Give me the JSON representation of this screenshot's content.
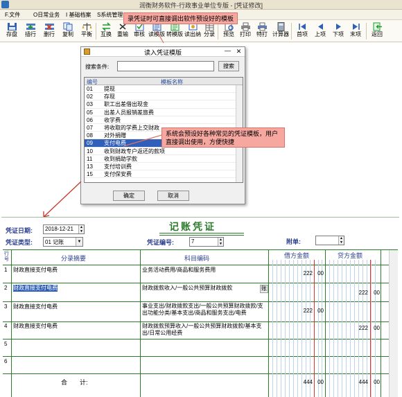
{
  "app": {
    "title": "润衡财务软件-行政事业单位专版 - [凭证修改]"
  },
  "menu": [
    {
      "label": "F.文件"
    },
    {
      "label": "O日常业务"
    },
    {
      "label": "I 基础档案"
    },
    {
      "label": "S系统管理"
    }
  ],
  "toolbar": [
    {
      "label": "存盘",
      "icon": "save-icon"
    },
    {
      "label": "插行",
      "icon": "insert-row-icon"
    },
    {
      "label": "删行",
      "icon": "delete-row-icon"
    },
    {
      "label": "复制",
      "icon": "copy-icon"
    },
    {
      "label": "平衡",
      "icon": "balance-icon"
    },
    {
      "label": "互换",
      "icon": "swap-icon"
    },
    {
      "label": "重输",
      "icon": "reset-icon"
    },
    {
      "label": "审核",
      "icon": "audit-icon"
    },
    {
      "label": "读模版",
      "icon": "read-template-icon"
    },
    {
      "label": "转模版",
      "icon": "save-template-icon"
    },
    {
      "label": "读出纳",
      "icon": "read-cashier-icon"
    },
    {
      "label": "分录",
      "icon": "entry-icon"
    },
    {
      "label": "预览",
      "icon": "preview-icon"
    },
    {
      "label": "打印",
      "icon": "print-icon"
    },
    {
      "label": "特打",
      "icon": "special-print-icon"
    },
    {
      "label": "计算器",
      "icon": "calculator-icon"
    },
    {
      "label": "首项",
      "icon": "first-icon"
    },
    {
      "label": "上项",
      "icon": "prev-icon"
    },
    {
      "label": "下项",
      "icon": "next-icon"
    },
    {
      "label": "末项",
      "icon": "last-icon"
    },
    {
      "label": "返回",
      "icon": "return-icon"
    }
  ],
  "callouts": {
    "top": "录凭证时可直接调出软件预设好的模板",
    "middle": "系统会预设好各种常见的凭证模板，用户直接调出使用，方便快捷"
  },
  "dialog": {
    "title": "读入凭证模版",
    "search_label": "搜索条件:",
    "search_value": "",
    "search_button": "搜索",
    "col_code": "编号",
    "col_name": "模板名称",
    "rows": [
      {
        "code": "01",
        "name": "提现"
      },
      {
        "code": "02",
        "name": "存现"
      },
      {
        "code": "03",
        "name": "职工出差借出现金"
      },
      {
        "code": "05",
        "name": "出差人员报销差旅费"
      },
      {
        "code": "06",
        "name": "收学费"
      },
      {
        "code": "07",
        "name": "将收取的学费上交财政"
      },
      {
        "code": "08",
        "name": "对外捐赠"
      },
      {
        "code": "09",
        "name": "支付电费"
      },
      {
        "code": "10",
        "name": "收到财政专户返还的款项"
      },
      {
        "code": "11",
        "name": "收到捐助学款"
      },
      {
        "code": "13",
        "name": "支付培训费"
      },
      {
        "code": "15",
        "name": "支付保安费"
      }
    ],
    "selected_index": 7,
    "ok": "确定",
    "cancel": "取消"
  },
  "voucher": {
    "title": "记账凭证",
    "date_label": "凭证日期:",
    "date_value": "2018-12-21",
    "type_label": "凭证类型:",
    "type_value": "01 记账",
    "number_label": "凭证编号:",
    "number_value": "7",
    "attach_label": "附单:",
    "attach_value": "",
    "col_rowno": "行号",
    "col_summary": "分录摘要",
    "col_account": "科目编码",
    "col_debit": "借方金额",
    "col_credit": "贷方金额",
    "digit_units": [
      "千",
      "百",
      "十",
      "亿",
      "千",
      "百",
      "十",
      "万",
      "千",
      "百",
      "十",
      "元",
      "角",
      "分"
    ],
    "rows": [
      {
        "no": "1",
        "summary": "财政直接支付电费",
        "account": "业务活动费用/商品和服务费用",
        "debit_int": "222",
        "debit_dec": "00",
        "credit_int": "",
        "credit_dec": ""
      },
      {
        "no": "2",
        "summary": "财政直接支付电费",
        "account": "财政拨款收入/一般公共预算财政拨款",
        "debit_int": "",
        "debit_dec": "",
        "credit_int": "222",
        "credit_dec": "00"
      },
      {
        "no": "3",
        "summary": "财政直接支付电费",
        "account": "事业支出/财政拨款支出/一般公共预算财政拨款/支出功能分类/基本支出/商品和服务支出/电费",
        "debit_int": "222",
        "debit_dec": "00",
        "credit_int": "",
        "credit_dec": ""
      },
      {
        "no": "4",
        "summary": "财政直接支付电费",
        "account": "财政拨款预算收入/一般公共预算财政拨款/基本支出/日常公用经费",
        "debit_int": "",
        "debit_dec": "",
        "credit_int": "222",
        "credit_dec": "00"
      },
      {
        "no": "5",
        "summary": "",
        "account": "",
        "debit_int": "",
        "debit_dec": "",
        "credit_int": "",
        "credit_dec": ""
      },
      {
        "no": "6",
        "summary": "",
        "account": "",
        "debit_int": "",
        "debit_dec": "",
        "credit_int": "",
        "credit_dec": ""
      }
    ],
    "row2_flag": "账",
    "total_label": "合　　计:",
    "total_debit_int": "444",
    "total_debit_dec": "00",
    "total_credit_int": "444",
    "total_credit_dec": "00"
  }
}
